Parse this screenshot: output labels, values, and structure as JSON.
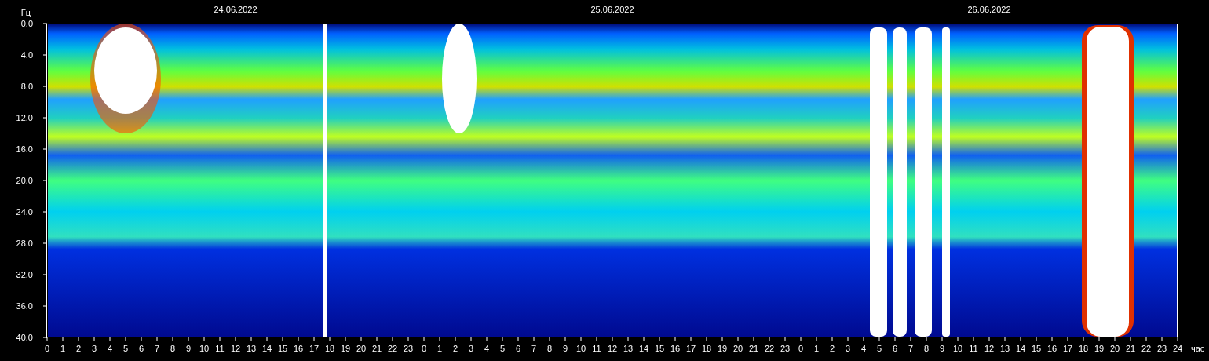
{
  "dates": [
    "24.06.2022",
    "25.06.2022",
    "26.06.2022"
  ],
  "y_axis": {
    "unit": "Гц",
    "ticks": [
      "0.0",
      "4.0",
      "8.0",
      "12.0",
      "16.0",
      "20.0",
      "24.0",
      "28.0",
      "32.0",
      "36.0",
      "40.0"
    ]
  },
  "x_axis": {
    "unit": "час",
    "ticks": [
      "0",
      "1",
      "2",
      "3",
      "4",
      "5",
      "6",
      "7",
      "8",
      "9",
      "10",
      "11",
      "12",
      "13",
      "14",
      "15",
      "16",
      "17",
      "18",
      "19",
      "20",
      "21",
      "22",
      "23",
      "0",
      "1",
      "2",
      "3",
      "4",
      "5",
      "6",
      "7",
      "8",
      "9",
      "10",
      "11",
      "12",
      "13",
      "14",
      "15",
      "16",
      "17",
      "18",
      "19",
      "20",
      "21",
      "22",
      "23",
      "0",
      "1",
      "2",
      "3",
      "4",
      "5",
      "6",
      "7",
      "8",
      "9",
      "10",
      "11",
      "12",
      "13",
      "14",
      "15",
      "16",
      "17",
      "18",
      "19",
      "20",
      "21",
      "22",
      "23",
      "24"
    ]
  }
}
